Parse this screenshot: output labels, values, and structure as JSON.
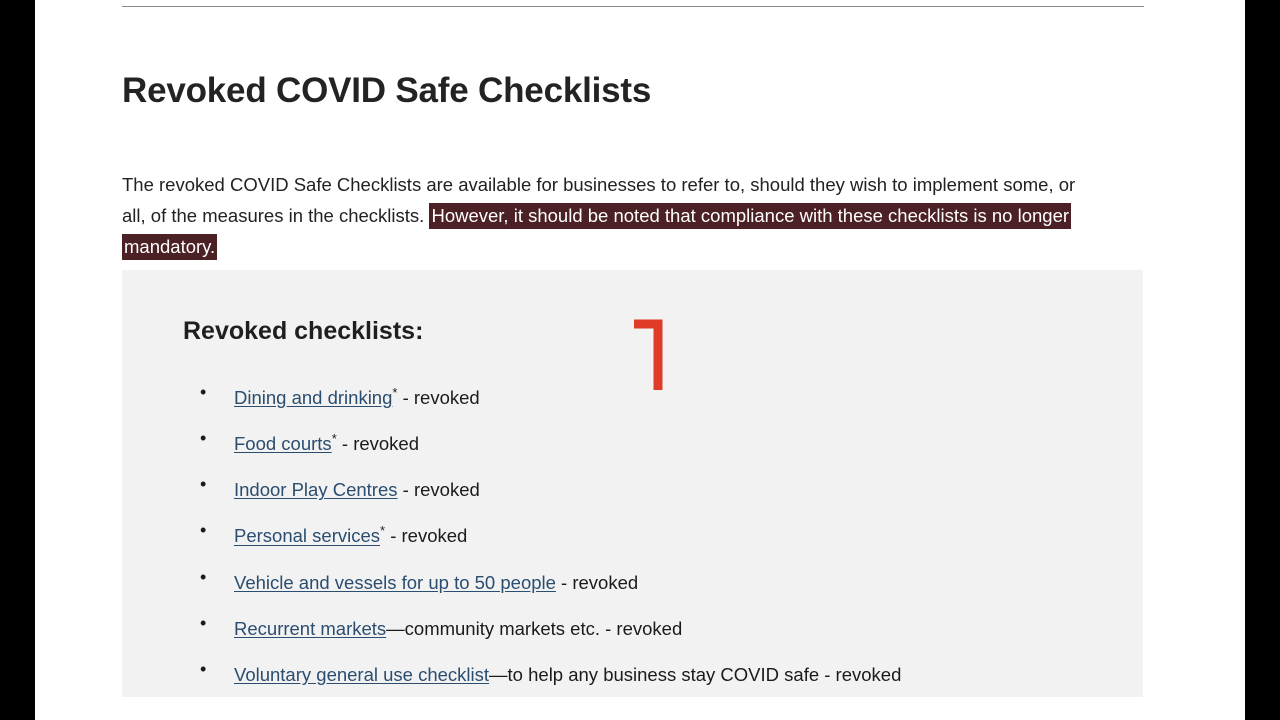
{
  "page": {
    "title": "Revoked COVID Safe Checklists",
    "intro": {
      "plain_text": "The revoked COVID Safe Checklists are available for businesses to refer to, should they wish to implement some, or all, of the measures in the checklists. ",
      "highlighted_text": "However, it should be noted that compliance with these checklists is no longer mandatory.",
      "highlight_color": "#4b2125",
      "highlight_text_color": "#ffffff"
    }
  },
  "panel": {
    "heading": "Revoked checklists:",
    "background_color": "#f2f2f2",
    "annotation": {
      "shape": "red-corner-bracket",
      "color": "#e03a28"
    },
    "items": [
      {
        "link": "Dining and drinking",
        "asterisk": "*",
        "suffix": " - revoked"
      },
      {
        "link": "Food courts",
        "asterisk": "*",
        "suffix": " - revoked"
      },
      {
        "link": "Indoor Play Centres",
        "asterisk": "",
        "suffix": " - revoked"
      },
      {
        "link": "Personal services",
        "asterisk": "*",
        "suffix": " - revoked"
      },
      {
        "link": "Vehicle and vessels for up to 50 people",
        "asterisk": "",
        "suffix": " - revoked"
      },
      {
        "link": "Recurrent markets",
        "asterisk": "",
        "suffix": "—community markets etc. - revoked"
      },
      {
        "link": "Voluntary general use checklist",
        "asterisk": "",
        "suffix": "—to help any business stay COVID safe - revoked"
      }
    ]
  },
  "colors": {
    "link": "#2a4d70",
    "text": "#1b1b1b",
    "rule": "#8a8a8a",
    "letterbox": "#000000"
  }
}
